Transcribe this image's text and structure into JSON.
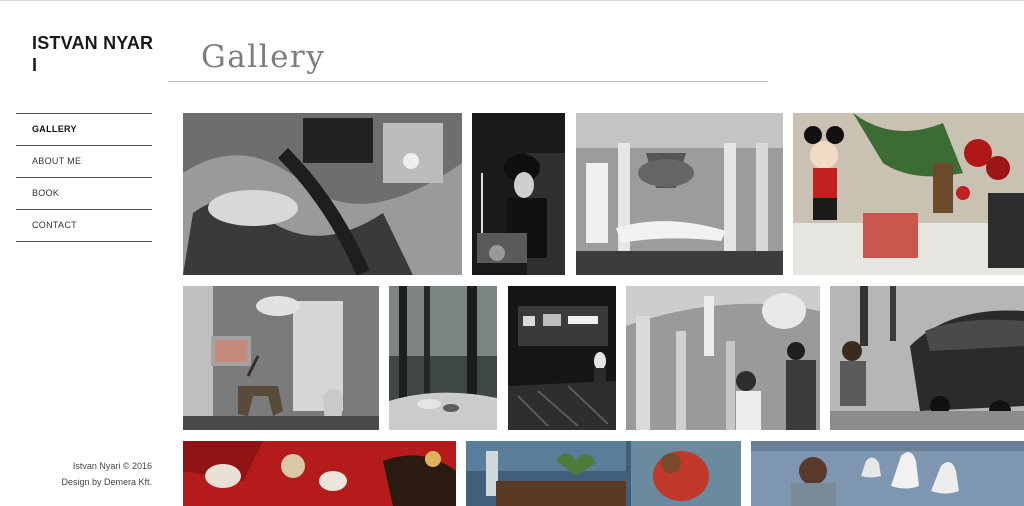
{
  "site": {
    "name": "ISTVAN NYARI"
  },
  "nav": [
    {
      "label": "GALLERY",
      "active": true
    },
    {
      "label": "ABOUT ME",
      "active": false
    },
    {
      "label": "BOOK",
      "active": false
    },
    {
      "label": "CONTACT",
      "active": false
    }
  ],
  "page": {
    "title": "Gallery"
  },
  "footer": {
    "copyright": "Istvan Nyari © 2016",
    "credit": "Design by Demera Kft."
  }
}
